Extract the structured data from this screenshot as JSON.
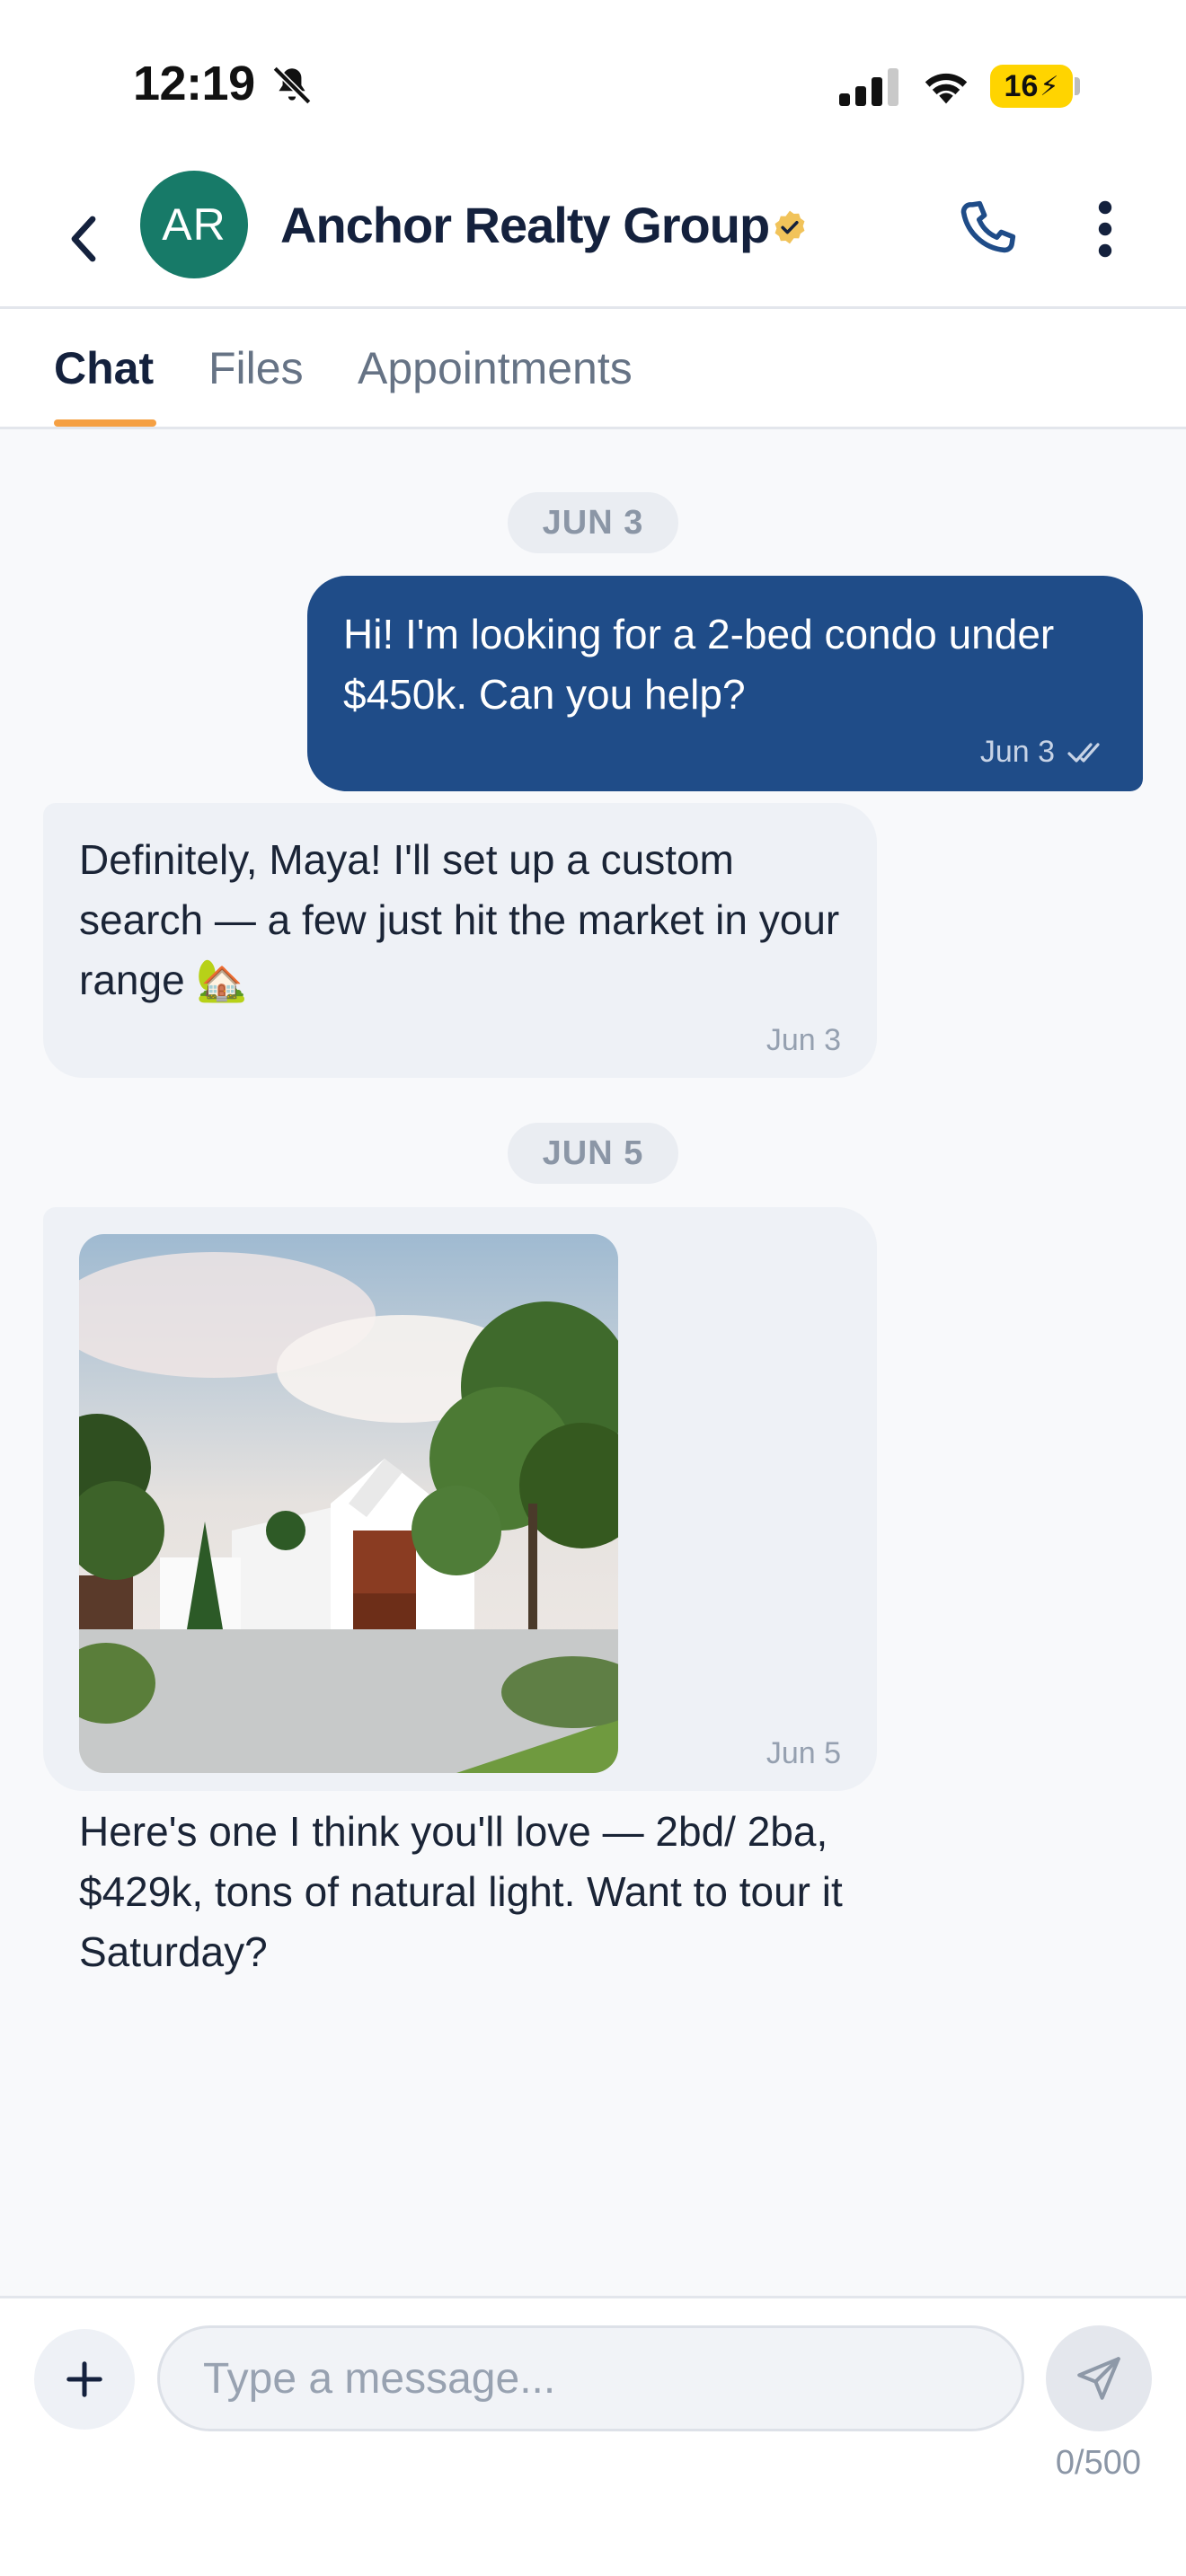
{
  "status_bar": {
    "time": "12:19",
    "battery": "16",
    "icons": [
      "bell-slash-icon",
      "cellular-signal-icon",
      "wifi-icon",
      "battery-charging-icon"
    ]
  },
  "header": {
    "avatar_initials": "AR",
    "avatar_color": "#177a68",
    "contact_name": "Anchor Realty Group",
    "verified_color": "#f1c35a",
    "icons": [
      "chevron-left-icon",
      "verified-badge-icon",
      "phone-icon",
      "more-vertical-icon"
    ]
  },
  "tabs": [
    {
      "label": "Chat",
      "active": true
    },
    {
      "label": "Files",
      "active": false
    },
    {
      "label": "Appointments",
      "active": false
    }
  ],
  "accent_color": "#f5a043",
  "messages": {
    "date_1": "JUN 3",
    "date_2": "JUN 5",
    "outgoing_1": {
      "text": "Hi! I'm looking for a 2-bed condo under $450k. Can you help?",
      "time": "Jun 3",
      "status": "read",
      "color": "#1f4c88"
    },
    "incoming_1": {
      "text": "Definitely, Maya! I'll set up a custom search — a few just hit the market in your range 🏡",
      "time": "Jun 3"
    },
    "incoming_2": {
      "image": "modern white house with palm trees and driveway",
      "text": "Here's one I think you'll love — 2bd/ 2ba, $429k, tons of natural light. Want to tour it Saturday?",
      "time": "Jun 5"
    }
  },
  "composer": {
    "placeholder": "Type a message...",
    "char_count": "0/500",
    "icons": [
      "plus-icon",
      "send-icon"
    ]
  }
}
